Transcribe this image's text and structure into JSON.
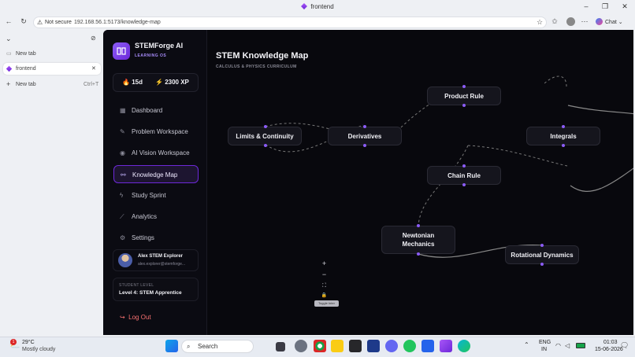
{
  "browser": {
    "window_title": "frontend",
    "security_label": "Not secure",
    "url": "192.168.56.1:5173/knowledge-map",
    "chat_label": "Chat",
    "tabs": [
      {
        "label": "New tab"
      },
      {
        "label": "frontend"
      },
      {
        "label": "New tab",
        "shortcut": "Ctrl+T"
      }
    ]
  },
  "app": {
    "brand": "STEMForge AI",
    "brand_sub": "LEARNING OS",
    "streak": "15d",
    "xp": "2300 XP",
    "nav": [
      {
        "label": "Dashboard",
        "icon": "grid-icon"
      },
      {
        "label": "Problem Workspace",
        "icon": "edit-icon"
      },
      {
        "label": "AI Vision Workspace",
        "icon": "eye-icon"
      },
      {
        "label": "Knowledge Map",
        "icon": "network-icon"
      },
      {
        "label": "Study Sprint",
        "icon": "bolt-icon"
      },
      {
        "label": "Analytics",
        "icon": "chart-icon"
      },
      {
        "label": "Settings",
        "icon": "gear-icon"
      }
    ],
    "active_nav": "Knowledge Map",
    "user": {
      "name": "Alex STEM Explorer",
      "email": "alex.explorer@stemforge..."
    },
    "level_label": "STUDENT LEVEL",
    "level_value": "Level 4: STEM Apprentice",
    "logout": "Log Out"
  },
  "map": {
    "title": "STEM Knowledge Map",
    "subtitle": "CALCULUS & PHYSICS CURRICULUM",
    "nodes": {
      "limits": "Limits & Continuity",
      "derivatives": "Derivatives",
      "product_rule": "Product Rule",
      "integrals": "Integrals",
      "chain_rule": "Chain Rule",
      "newtonian": "Newtonian Mechanics",
      "rotational": "Rotational Dynamics"
    },
    "controls": {
      "zoom_in": "+",
      "zoom_out": "−",
      "fit": "⛶",
      "lock": "🔒"
    },
    "tooltip": "Toggle Inter"
  },
  "taskbar": {
    "weather_temp": "29°C",
    "weather_desc": "Mostly cloudy",
    "weather_badge": "1",
    "search_label": "Search",
    "lang_1": "ENG",
    "lang_2": "IN",
    "time": "01:03",
    "date": "15-06-2026"
  },
  "colors": {
    "accent": "#8b5cf6",
    "app_bg": "#08080d",
    "logout": "#f87171"
  }
}
